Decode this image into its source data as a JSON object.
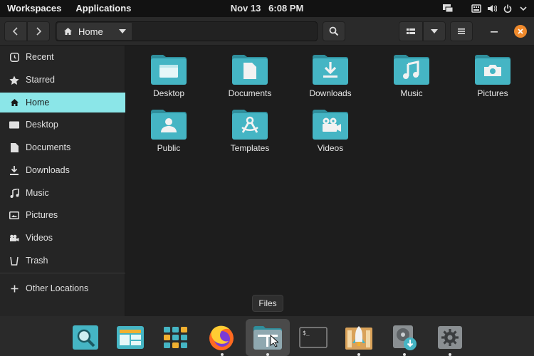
{
  "topbar": {
    "workspaces": "Workspaces",
    "applications": "Applications",
    "date": "Nov 13",
    "time": "6:08 PM"
  },
  "header": {
    "location_label": "Home"
  },
  "sidebar": {
    "items": [
      {
        "label": "Recent",
        "icon": "clock-icon"
      },
      {
        "label": "Starred",
        "icon": "star-icon"
      },
      {
        "label": "Home",
        "icon": "home-icon"
      },
      {
        "label": "Desktop",
        "icon": "desktop-icon"
      },
      {
        "label": "Documents",
        "icon": "document-icon"
      },
      {
        "label": "Downloads",
        "icon": "download-icon"
      },
      {
        "label": "Music",
        "icon": "music-icon"
      },
      {
        "label": "Pictures",
        "icon": "picture-icon"
      },
      {
        "label": "Videos",
        "icon": "video-icon"
      },
      {
        "label": "Trash",
        "icon": "trash-icon"
      }
    ],
    "other_locations": "Other Locations",
    "active": "Home"
  },
  "folders": [
    {
      "label": "Desktop",
      "emblem": "desktop"
    },
    {
      "label": "Documents",
      "emblem": "document"
    },
    {
      "label": "Downloads",
      "emblem": "download"
    },
    {
      "label": "Music",
      "emblem": "music"
    },
    {
      "label": "Pictures",
      "emblem": "camera"
    },
    {
      "label": "Public",
      "emblem": "person"
    },
    {
      "label": "Templates",
      "emblem": "compass"
    },
    {
      "label": "Videos",
      "emblem": "video-camera"
    }
  ],
  "tooltip": "Files",
  "colors": {
    "accent": "#8be6e8",
    "folder_body": "#45b5c4",
    "folder_tab": "#2f8e9c",
    "close_button": "#f08a2c"
  },
  "dock": [
    "search-app-icon",
    "window-manager-icon",
    "app-grid-icon",
    "firefox-icon",
    "files-icon",
    "terminal-icon",
    "software-store-icon",
    "disk-installer-icon",
    "settings-icon"
  ]
}
